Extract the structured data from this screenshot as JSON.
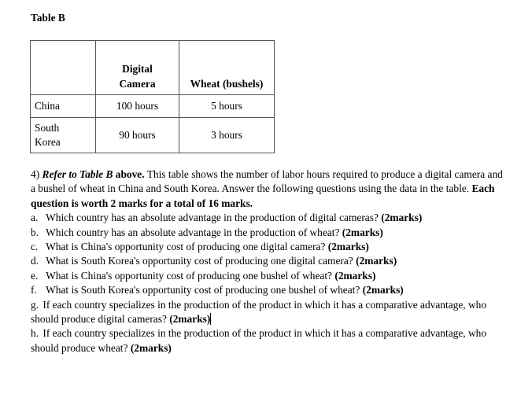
{
  "table_title": "Table B",
  "table": {
    "headers": [
      "",
      "Digital Camera",
      "Wheat (bushels)"
    ],
    "header_lines": {
      "camera_1": "Digital",
      "camera_2": "Camera"
    },
    "rows": [
      {
        "country": "China",
        "camera": "100 hours",
        "wheat": "5 hours"
      },
      {
        "country_1": "South",
        "country_2": "Korea",
        "country": "South Korea",
        "camera": "90 hours",
        "wheat": "3 hours"
      }
    ]
  },
  "question": {
    "number": "4)",
    "refer": "Refer to Table B",
    "above": "above.",
    "intro": " This table shows the number of labor hours required to produce a digital camera and a bushel of wheat in China and South Korea. Answer the following questions using the data in the table. ",
    "marks_note": "Each question is worth 2 marks for a total of 16 marks.",
    "items": [
      {
        "label": "a.",
        "text": "Which country has an absolute advantage in the production of digital cameras?  ",
        "marks": "(2marks)"
      },
      {
        "label": "b.",
        "text": "Which country has an absolute advantage in the production of wheat? ",
        "marks": "(2marks)"
      },
      {
        "label": "c.",
        "text": "What is China's opportunity cost of producing one digital camera? ",
        "marks": "(2marks)"
      },
      {
        "label": "d.",
        "text": "What is South Korea's opportunity cost of producing one digital camera? ",
        "marks": "(2marks)"
      },
      {
        "label": "e.",
        "text": "What is China's opportunity cost of producing one bushel of wheat? ",
        "marks": "(2marks)"
      },
      {
        "label": "f.",
        "text": "What is South Korea's opportunity cost of producing one bushel of wheat? ",
        "marks": "(2marks)"
      },
      {
        "label": "g.",
        "text": "If each country specializes in the production of the product in which it has a comparative advantage, who should produce digital cameras? ",
        "marks": "(2marks)"
      },
      {
        "label": "h.",
        "text": "If each country specializes in the production of the product in which it has a comparative advantage, who should produce wheat? ",
        "marks": "(2marks)"
      }
    ]
  }
}
